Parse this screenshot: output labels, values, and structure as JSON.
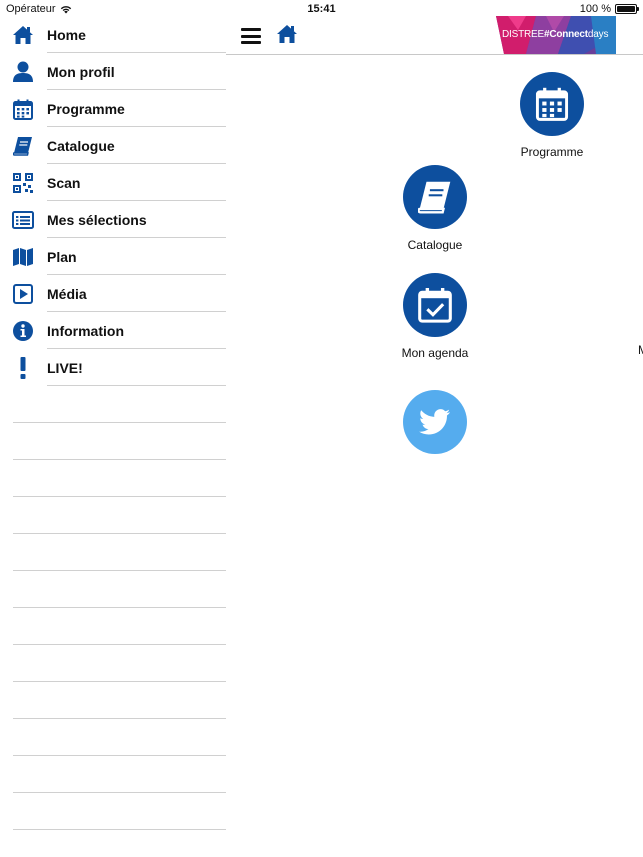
{
  "status_bar": {
    "carrier": "Opérateur",
    "time": "15:41",
    "battery": "100 %"
  },
  "sidebar": {
    "items": [
      {
        "label": "Home",
        "icon": "home-icon"
      },
      {
        "label": "Mon profil",
        "icon": "user-icon"
      },
      {
        "label": "Programme",
        "icon": "calendar-icon"
      },
      {
        "label": "Catalogue",
        "icon": "book-icon"
      },
      {
        "label": "Scan",
        "icon": "qr-code-icon"
      },
      {
        "label": "Mes sélections",
        "icon": "list-icon"
      },
      {
        "label": "Plan",
        "icon": "map-icon"
      },
      {
        "label": "Média",
        "icon": "play-icon"
      },
      {
        "label": "Information",
        "icon": "info-icon"
      },
      {
        "label": "LIVE!",
        "icon": "exclamation-icon"
      }
    ]
  },
  "header": {
    "logo_prefix": "DISTREE",
    "logo_hash": "#Connect",
    "logo_suffix": "days"
  },
  "grid": {
    "tiles": [
      {
        "label": "Programme",
        "icon": "calendar-icon"
      },
      {
        "label": "Catalogue",
        "icon": "book-icon"
      },
      {
        "label": "Mon agenda",
        "icon": "calendar-check-icon"
      },
      {
        "label": "M",
        "icon": "cut-off-icon"
      },
      {
        "label": "",
        "icon": "twitter-icon"
      }
    ]
  },
  "colors": {
    "brand_blue": "#0d4f9e",
    "twitter_blue": "#55acee",
    "divider": "#d0d0d0"
  }
}
